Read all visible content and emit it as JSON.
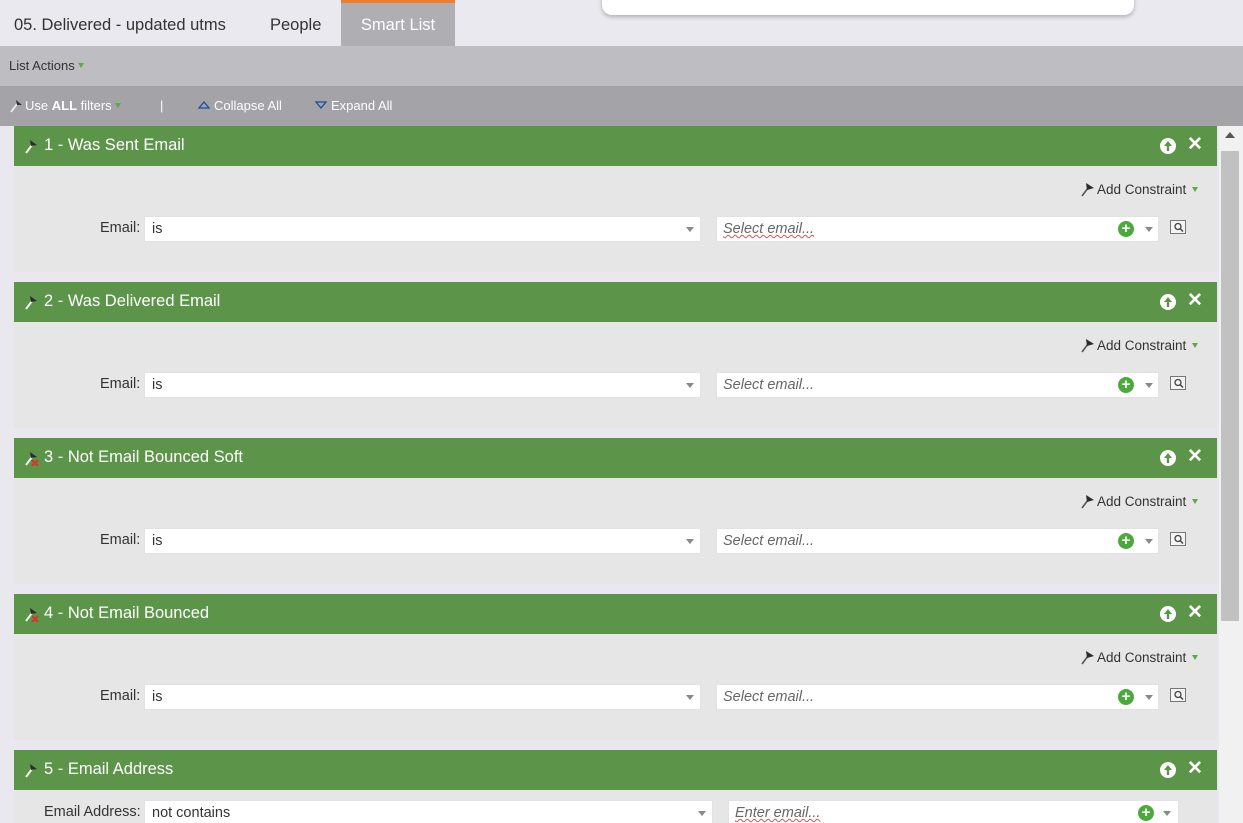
{
  "tabs": [
    {
      "label": "05. Delivered - updated utms",
      "active": false
    },
    {
      "label": "People",
      "active": false
    },
    {
      "label": "Smart List",
      "active": true
    }
  ],
  "list_actions": {
    "label": "List Actions"
  },
  "filter_bar": {
    "use_prefix": "Use ",
    "use_bold": "ALL",
    "use_suffix": " filters",
    "separator": "|",
    "collapse_all": "Collapse All",
    "expand_all": "Expand All"
  },
  "add_constraint_label": "Add Constraint",
  "filters": [
    {
      "title": "1 - Was Sent Email",
      "field_label": "Email:",
      "operator": "is",
      "value_placeholder": "Select email...",
      "icon": "wand-icon"
    },
    {
      "title": "2 - Was Delivered Email",
      "field_label": "Email:",
      "operator": "is",
      "value_placeholder": "Select email...",
      "icon": "wand-icon"
    },
    {
      "title": "3 - Not Email Bounced Soft",
      "field_label": "Email:",
      "operator": "is",
      "value_placeholder": "Select email...",
      "icon": "wand-negated-icon"
    },
    {
      "title": "4 - Not Email Bounced",
      "field_label": "Email:",
      "operator": "is",
      "value_placeholder": "Select email...",
      "icon": "wand-negated-icon"
    },
    {
      "title": "5 - Email Address",
      "field_label": "Email Address:",
      "operator": "not contains",
      "value_placeholder": "Enter email...",
      "icon": "wand-icon"
    }
  ],
  "colors": {
    "filter_header": "#5c9449",
    "active_tab": "#aeaeb3",
    "tab_accent": "#f07c2e",
    "add_green": "#4caa3c"
  }
}
